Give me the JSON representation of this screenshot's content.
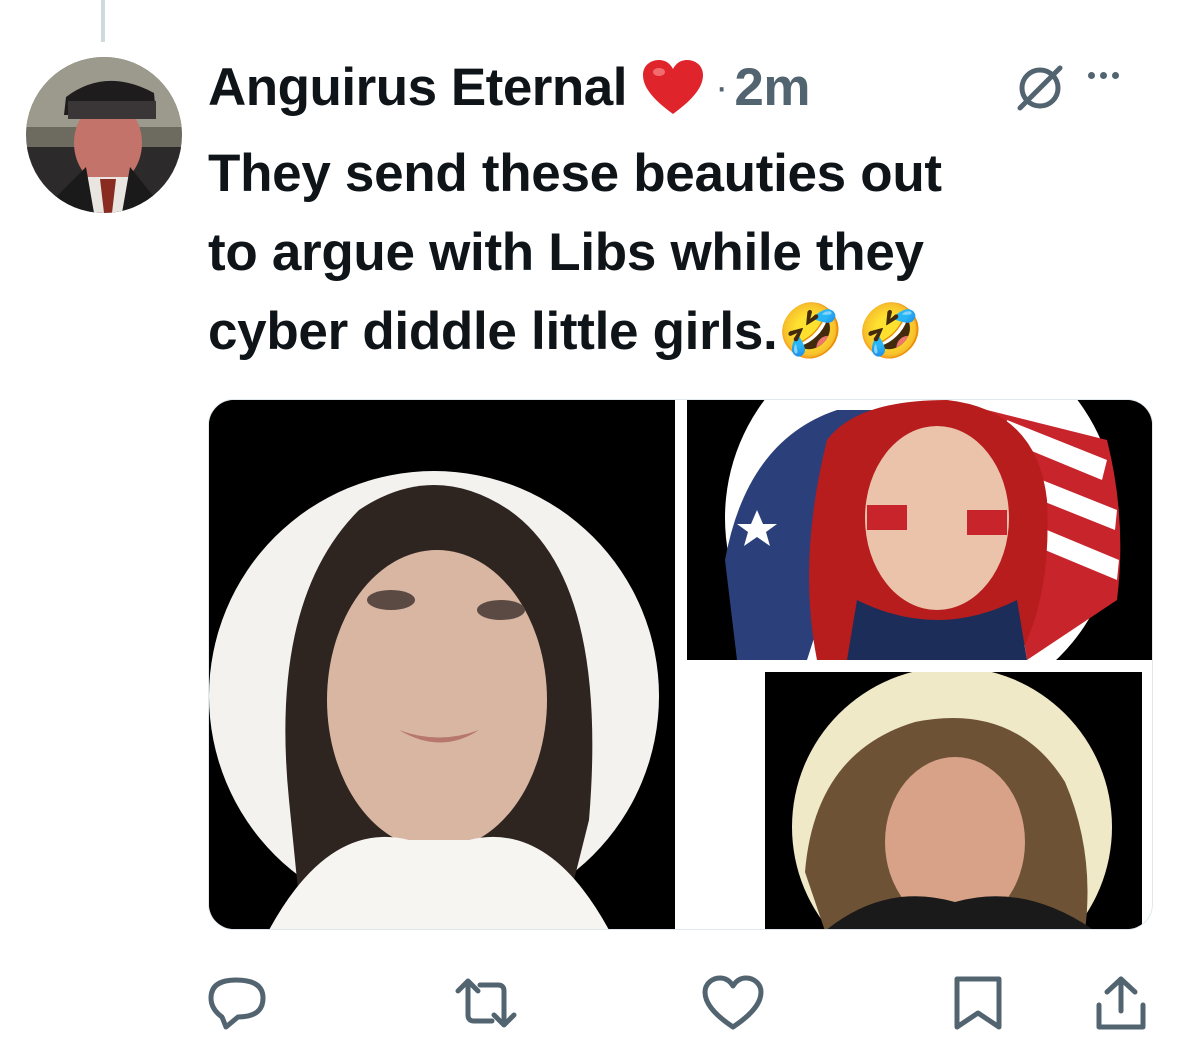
{
  "tweet": {
    "author_name": "Anguirus Eternal",
    "author_emoji": "heart",
    "separator": "·",
    "timestamp": "2m",
    "lines": [
      "They send these beauties out",
      "to argue with Libs while they",
      "cyber diddle little girls."
    ],
    "emojis": [
      "🤣",
      "🤣"
    ]
  },
  "media": {
    "count": 3,
    "descriptions_hidden": true
  },
  "actions": {
    "reply_icon": "reply-icon",
    "retweet_icon": "retweet-icon",
    "like_icon": "heart-icon",
    "bookmark_icon": "bookmark-icon",
    "share_icon": "share-icon"
  },
  "colors": {
    "text": "#0f1419",
    "muted": "#536471",
    "heart": "#e0242b",
    "thread_line": "#cfd9de"
  }
}
